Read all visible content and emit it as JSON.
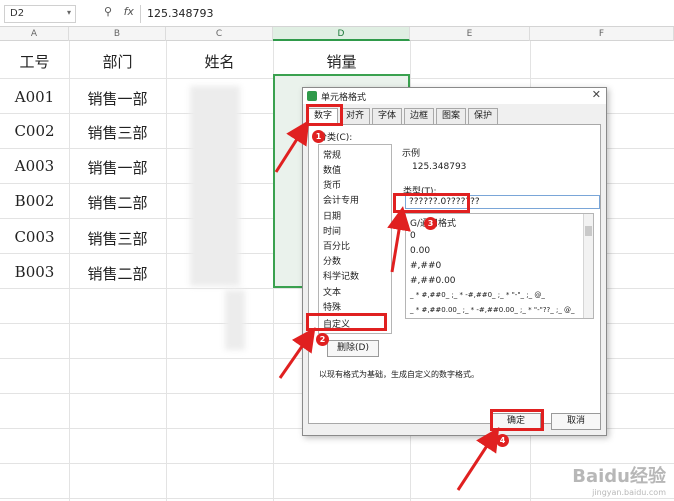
{
  "formula_bar": {
    "name_box": "D2",
    "icons": [
      "zoom-icon",
      "fx-icon"
    ],
    "fx_label": "fx",
    "value": "125.348793"
  },
  "columns": [
    "A",
    "B",
    "C",
    "D",
    "E",
    "F"
  ],
  "header_row": {
    "a": "工号",
    "b": "部门",
    "c": "姓名",
    "d": "销量"
  },
  "rows": [
    {
      "id": "A001",
      "dept": "销售一部"
    },
    {
      "id": "C002",
      "dept": "销售三部"
    },
    {
      "id": "A003",
      "dept": "销售一部"
    },
    {
      "id": "B002",
      "dept": "销售二部"
    },
    {
      "id": "C003",
      "dept": "销售三部"
    },
    {
      "id": "B003",
      "dept": "销售二部"
    }
  ],
  "dialog": {
    "title": "单元格格式",
    "tabs": [
      "数字",
      "对齐",
      "字体",
      "边框",
      "图案",
      "保护"
    ],
    "category_label": "分类(C):",
    "categories": [
      "常规",
      "数值",
      "货币",
      "会计专用",
      "日期",
      "时间",
      "百分比",
      "分数",
      "科学记数",
      "文本",
      "特殊",
      "自定义"
    ],
    "sample_label": "示例",
    "sample_value": "125.348793",
    "type_label": "类型(T):",
    "type_value": "??????.0???????",
    "formats": [
      "G/通用格式",
      "0",
      "0.00",
      "#,##0",
      "#,##0.00",
      "_ * #,##0_ ;_ * -#,##0_ ;_ * \"-\"_ ;_ @_",
      "_ * #,##0.00_ ;_ * -#,##0.00_ ;_ * \"-\"??_ ;_ @_"
    ],
    "delete_button": "删除(D)",
    "hint": "以现有格式为基础，生成自定义的数字格式。",
    "ok_button": "确定",
    "cancel_button": "取消"
  },
  "badges": [
    "1",
    "2",
    "3",
    "4"
  ],
  "watermark": "Baidu经验",
  "watermark_sub": "jingyan.baidu.com",
  "colors": {
    "annotation_red": "#e02020",
    "select_green": "#3aa14f"
  }
}
